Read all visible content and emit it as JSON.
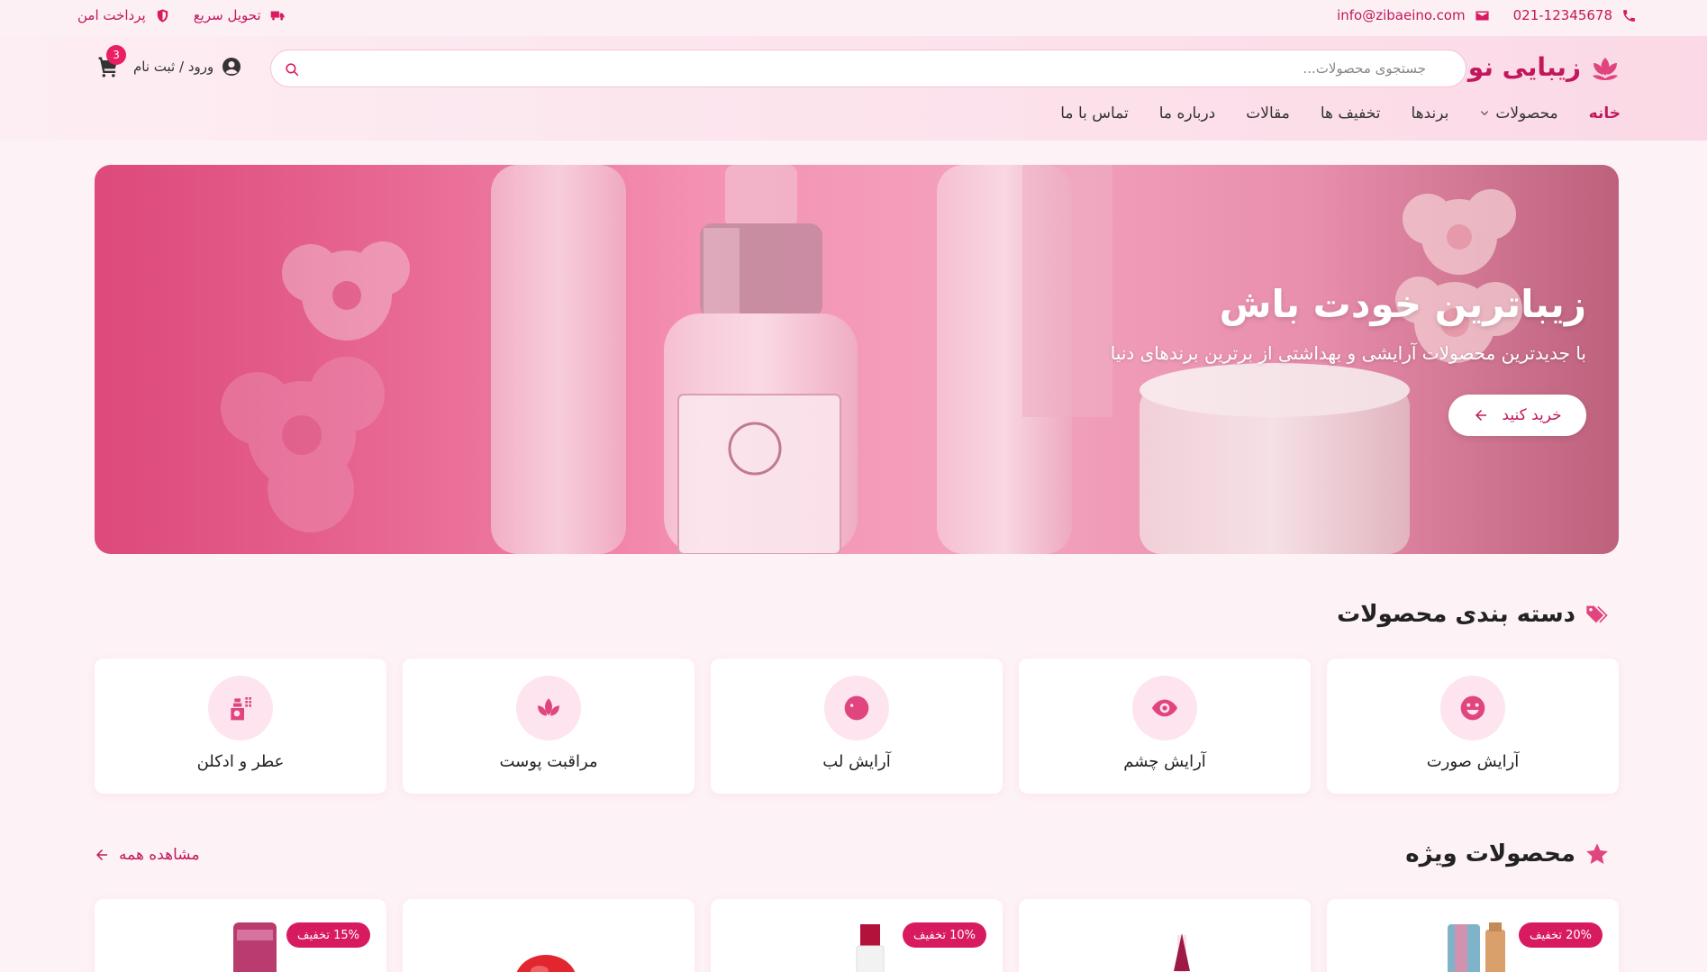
{
  "topbar": {
    "phone": "021-12345678",
    "email": "info@zibaeino.com",
    "fast_delivery": "تحویل سریع",
    "secure_payment": "پرداخت امن"
  },
  "header": {
    "brand": "زیبایی نو",
    "search_placeholder": "جستجوی محصولات...",
    "account_label": "ورود / ثبت نام",
    "cart_count": "3"
  },
  "nav": {
    "items": [
      {
        "label": "خانه",
        "active": true
      },
      {
        "label": "محصولات"
      },
      {
        "label": "برندها"
      },
      {
        "label": "تخفیف ها"
      },
      {
        "label": "مقالات"
      },
      {
        "label": "درباره ما"
      },
      {
        "label": "تماس با ما"
      }
    ]
  },
  "hero": {
    "title": "زیباترین خودت باش",
    "subtitle": "با جدیدترین محصولات آرایشی و بهداشتی از برترین برندهای دنیا",
    "cta": "خرید کنید"
  },
  "categories": {
    "title": "دسته بندی محصولات",
    "items": [
      {
        "label": "آرایش صورت",
        "icon": "smile-icon"
      },
      {
        "label": "آرایش چشم",
        "icon": "eye-icon"
      },
      {
        "label": "آرایش لب",
        "icon": "kiss-icon"
      },
      {
        "label": "مراقبت پوست",
        "icon": "spa-lotus-icon"
      },
      {
        "label": "عطر و ادکلن",
        "icon": "spray-bottle-icon"
      }
    ]
  },
  "featured": {
    "title": "محصولات ویژه",
    "view_all": "مشاهده همه",
    "products": [
      {
        "discount": "20% تخفیف"
      },
      {
        "discount": ""
      },
      {
        "discount": "10% تخفیف"
      },
      {
        "discount": ""
      },
      {
        "discount": "15% تخفیف"
      }
    ]
  },
  "colors": {
    "accent": "#d81b60",
    "accent_light": "#fde4ee",
    "background": "#fdf2f5"
  }
}
